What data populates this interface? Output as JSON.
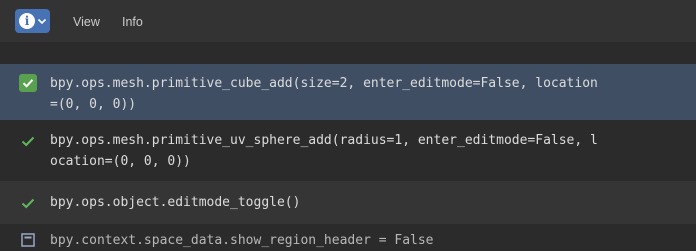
{
  "header": {
    "editor_type_icon": "info-icon",
    "editor_type_glyph": "i",
    "menu": [
      "View",
      "Info"
    ]
  },
  "colors": {
    "accent": "#4772b3",
    "selected_row": "#3f4e63",
    "check_green": "#57a14f"
  },
  "reports": [
    {
      "line1": "bpy.ops.mesh.primitive_cube_add(size=2, enter_editmode=False, location",
      "line2": "=(0, 0, 0))",
      "icon": "check-icon",
      "selected": true
    },
    {
      "line1": "bpy.ops.mesh.primitive_uv_sphere_add(radius=1, enter_editmode=False, l",
      "line2": "ocation=(0, 0, 0))",
      "icon": "check-icon",
      "selected": false
    },
    {
      "line1": "bpy.ops.object.editmode_toggle()",
      "icon": "check-icon",
      "selected": false
    },
    {
      "line1": "bpy.context.space_data.show_region_header = False",
      "icon": "info-report-icon",
      "selected": false
    }
  ]
}
